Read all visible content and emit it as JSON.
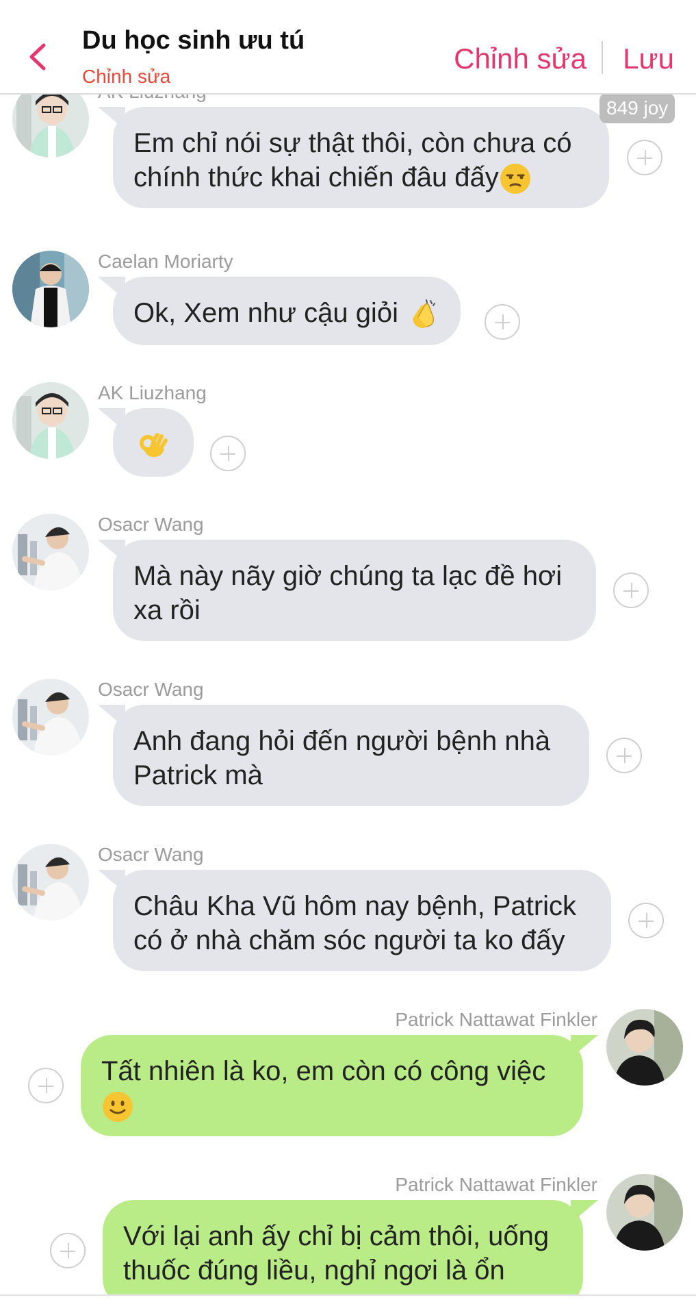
{
  "header": {
    "title": "Du học sinh ưu tú",
    "subtitle": "Chỉnh sửa",
    "edit_label": "Chỉnh sửa",
    "save_label": "Lưu"
  },
  "badge": {
    "joy": "849 joy"
  },
  "messages": [
    {
      "sender": "AK Liuzhang",
      "line1": "Em chỉ nói sự thật thôi, còn chưa có",
      "line2": "chính thức khai chiến đâu đấy",
      "emoji": "unamused-face-emoji"
    },
    {
      "sender": "Caelan Moriarty",
      "line1": "Ok, Xem như cậu giỏi",
      "emoji": "clapping-hands-emoji"
    },
    {
      "sender": "AK Liuzhang",
      "emoji": "ok-hand-emoji"
    },
    {
      "sender": "Osacr Wang",
      "line1": "Mà này nãy giờ chúng ta lạc đề hơi",
      "line2": "xa rồi"
    },
    {
      "sender": "Osacr Wang",
      "line1": "Anh đang hỏi đến người bệnh nhà",
      "line2": "Patrick mà"
    },
    {
      "sender": "Osacr Wang",
      "line1": "Châu Kha Vũ hôm nay bệnh, Patrick",
      "line2": "có ở nhà chăm sóc người ta ko đấy"
    },
    {
      "sender": "Patrick Nattawat Finkler",
      "line1": "Tất nhiên là ko, em còn có công việc",
      "emoji": "slightly-smiling-face-emoji"
    },
    {
      "sender": "Patrick Nattawat Finkler",
      "line1": "Với lại anh ấy chỉ bị cảm thôi, uống",
      "line2": "thuốc đúng liều, nghỉ ngơi là ổn"
    }
  ],
  "colors": {
    "accent": "#e3386e",
    "subtitle": "#e64a3a",
    "incoming_bubble": "#e3e5ea",
    "outgoing_bubble": "#b9ec86",
    "sender_label": "#9b9b9b"
  }
}
